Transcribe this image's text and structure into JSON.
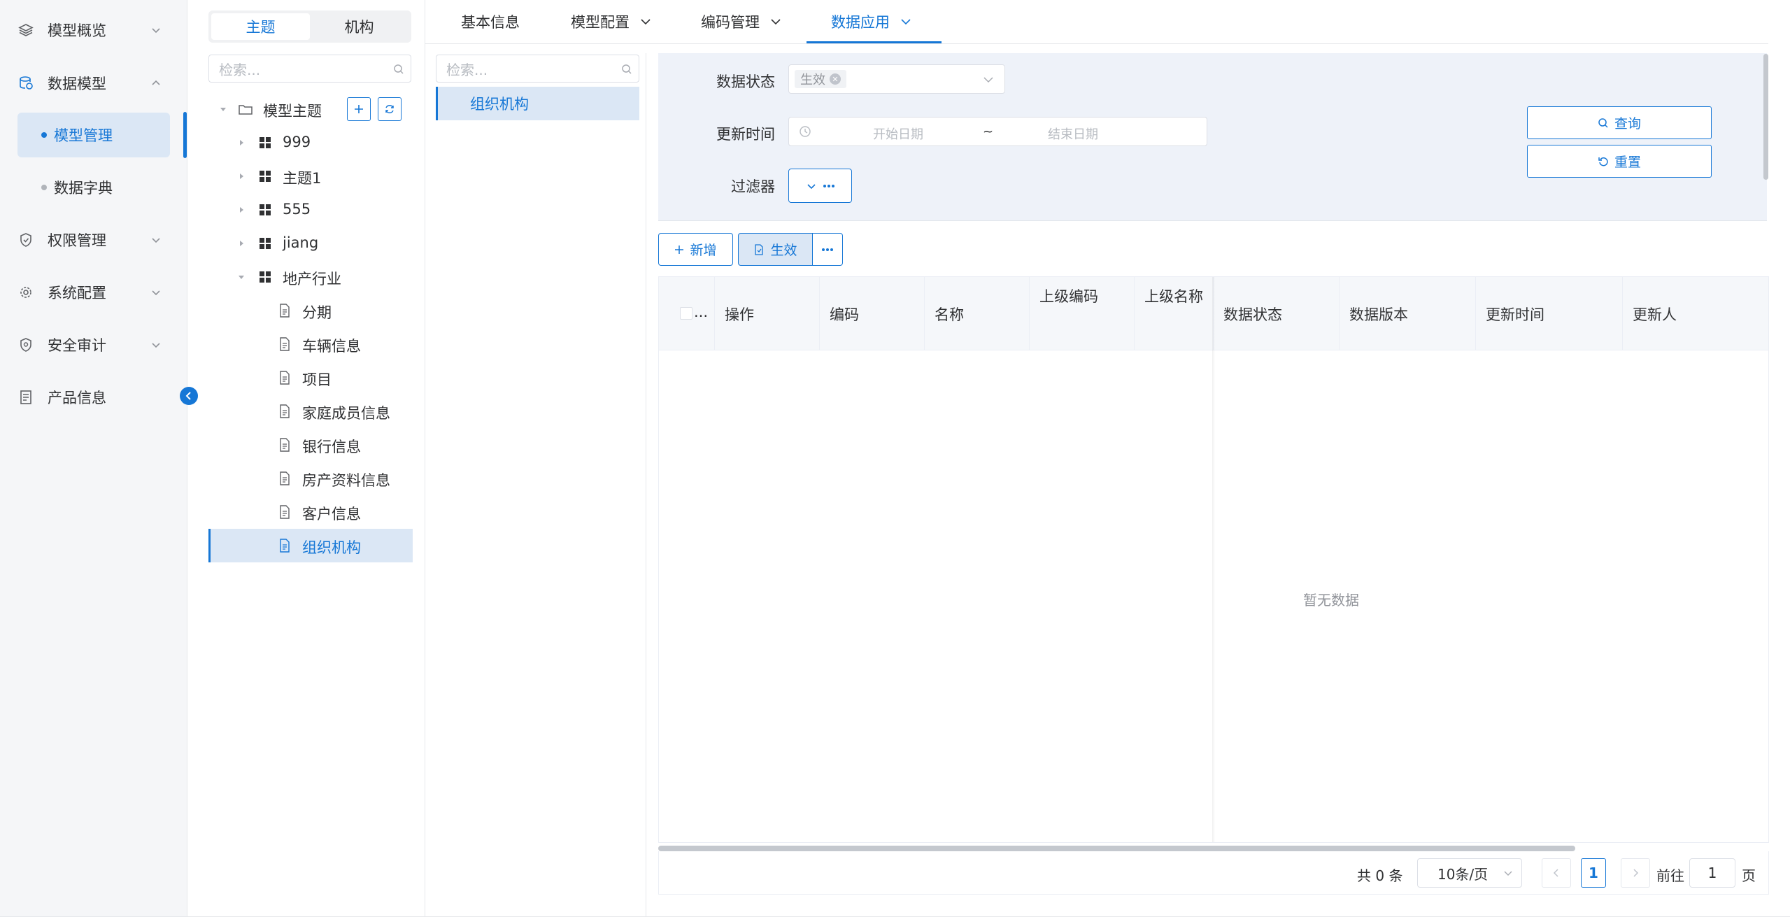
{
  "nav": {
    "items": [
      {
        "label": "模型概览",
        "icon": "layers-icon"
      },
      {
        "label": "数据模型",
        "icon": "database-icon"
      },
      {
        "label": "权限管理",
        "icon": "shield-icon"
      },
      {
        "label": "系统配置",
        "icon": "gear-icon"
      },
      {
        "label": "安全审计",
        "icon": "audit-shield-icon"
      },
      {
        "label": "产品信息",
        "icon": "document-list-icon"
      }
    ],
    "sub_items": [
      {
        "label": "模型管理"
      },
      {
        "label": "数据字典"
      }
    ]
  },
  "tree_panel": {
    "tabs": [
      "主题",
      "机构"
    ],
    "search_placeholder": "检索...",
    "root_label": "模型主题",
    "topics": [
      "999",
      "主题1",
      "555",
      "jiang",
      "地产行业"
    ],
    "children": [
      "分期",
      "车辆信息",
      "项目",
      "家庭成员信息",
      "银行信息",
      "房产资料信息",
      "客户信息",
      "组织机构"
    ]
  },
  "tabs": [
    {
      "label": "基本信息"
    },
    {
      "label": "模型配置"
    },
    {
      "label": "编码管理"
    },
    {
      "label": "数据应用"
    }
  ],
  "mid_list": {
    "search_placeholder": "检索...",
    "items": [
      "组织机构"
    ]
  },
  "filter": {
    "status_label": "数据状态",
    "status_tag": "生效",
    "time_label": "更新时间",
    "start_placeholder": "开始日期",
    "range_sep": "~",
    "end_placeholder": "结束日期",
    "filter_label": "过滤器",
    "query_label": "查询",
    "reset_label": "重置"
  },
  "toolbar": {
    "add_label": "新增",
    "effect_label": "生效"
  },
  "table": {
    "checkbox_header": "...",
    "columns": [
      "操作",
      "编码",
      "名称",
      "上级编码",
      "上级名称",
      "数据状态",
      "数据版本",
      "更新时间",
      "更新人"
    ],
    "empty_text": "暂无数据"
  },
  "pagination": {
    "total_text": "共 0 条",
    "page_size": "10条/页",
    "current_page": "1",
    "goto_prefix": "前往",
    "goto_value": "1",
    "goto_suffix": "页"
  },
  "colors": {
    "accent": "#1677d6",
    "selected_bg": "#dbe7f5",
    "filter_bg": "#eef2f9"
  }
}
